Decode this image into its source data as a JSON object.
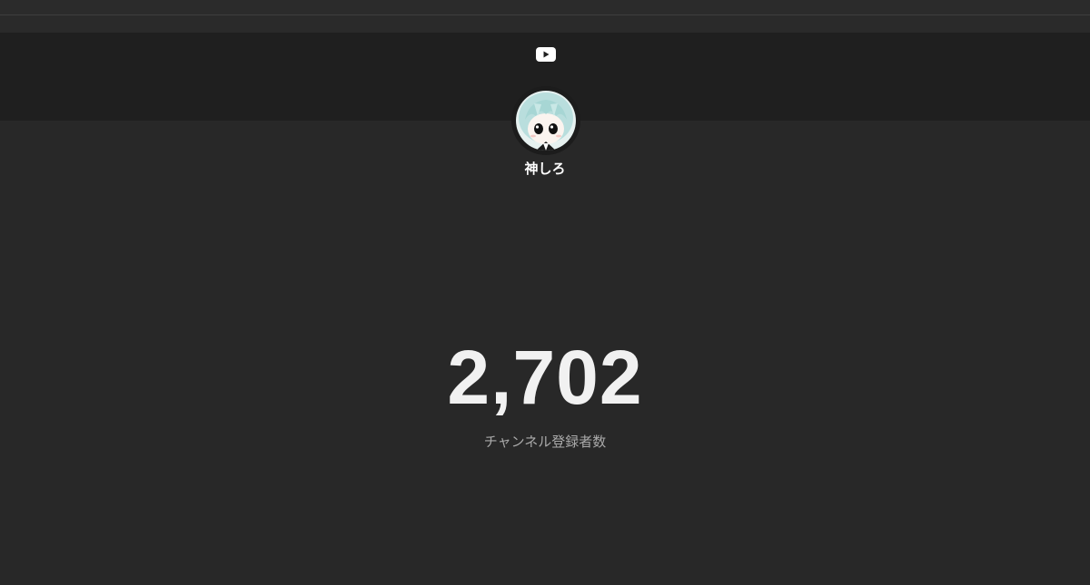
{
  "header": {
    "logo_icon": "youtube-play-icon"
  },
  "channel": {
    "name": "神しろ",
    "avatar_icon": "anime-avatar"
  },
  "stats": {
    "subscriber_count": "2,702",
    "subscriber_label": "チャンネル登録者数"
  },
  "colors": {
    "background": "#282828",
    "banner": "#1f1f1f",
    "text_primary": "#f1f1f1",
    "text_secondary": "#aaaaaa"
  }
}
